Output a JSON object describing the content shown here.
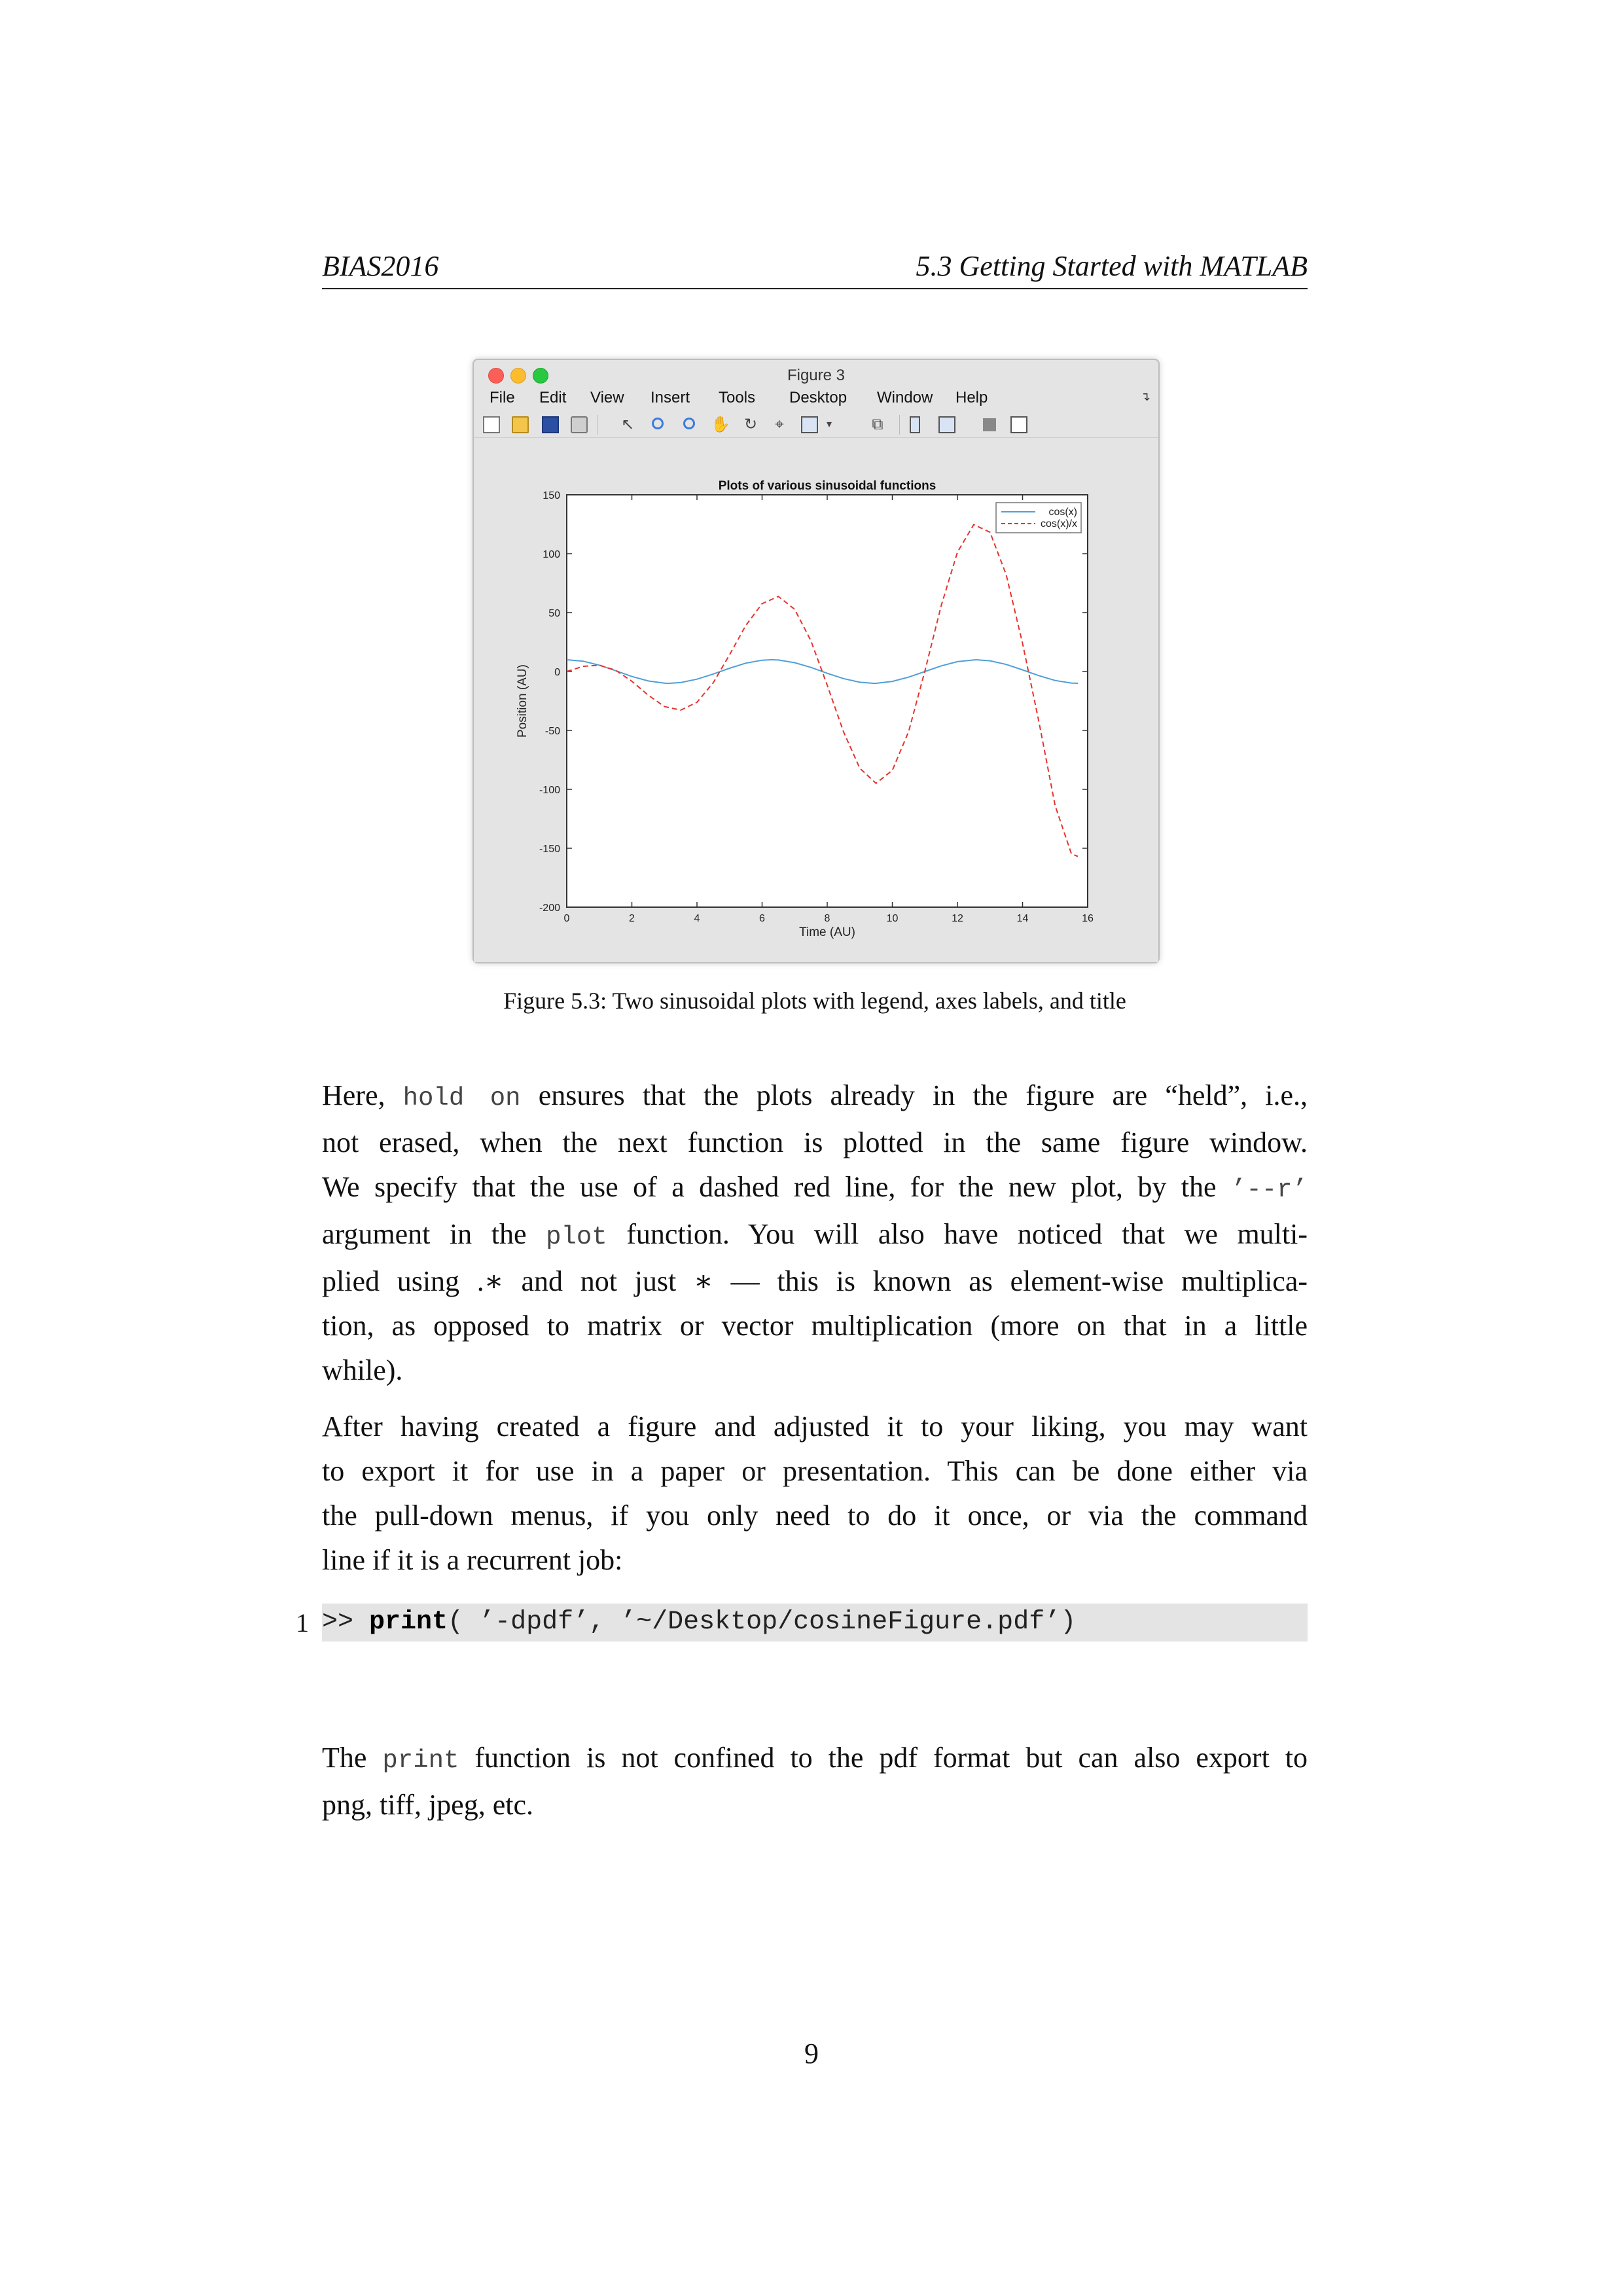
{
  "header": {
    "left": "BIAS2016",
    "right": "5.3 Getting Started with MATLAB"
  },
  "window": {
    "title": "Figure 3",
    "menu": [
      "File",
      "Edit",
      "View",
      "Insert",
      "Tools",
      "Desktop",
      "Window",
      "Help"
    ],
    "menu_overflow_icon": "arrow-icon",
    "toolbar_icons": [
      "new-figure-icon",
      "open-file-icon",
      "save-icon",
      "print-icon",
      "pointer-icon",
      "zoom-in-icon",
      "zoom-out-icon",
      "pan-icon",
      "rotate-icon",
      "data-cursor-icon",
      "brush-icon",
      "link-icon",
      "colorbar-icon",
      "legend-icon",
      "hide-tools-icon",
      "show-tools-icon"
    ]
  },
  "chart_data": {
    "type": "line",
    "title": "Plots of various sinusoidal functions",
    "xlabel": "Time (AU)",
    "ylabel": "Position (AU)",
    "xlim": [
      0,
      16
    ],
    "ylim": [
      -200,
      150
    ],
    "xticks": [
      "0",
      "2",
      "4",
      "6",
      "8",
      "10",
      "12",
      "14",
      "16"
    ],
    "yticks": [
      "150",
      "100",
      "50",
      "0",
      "-50",
      "-100",
      "-150",
      "-200"
    ],
    "grid": false,
    "legend_position": "top-right",
    "series": [
      {
        "name": "cos(x)",
        "style": "solid",
        "color": "#4f9fd8",
        "x": [
          0,
          0.5,
          1,
          1.5,
          2,
          2.5,
          3,
          3.14,
          3.5,
          4,
          4.5,
          5,
          5.5,
          6,
          6.28,
          6.5,
          7,
          7.5,
          8,
          8.5,
          9,
          9.42,
          9.5,
          10,
          10.5,
          11,
          11.5,
          12,
          12.57,
          13,
          13.5,
          14,
          14.5,
          15,
          15.5,
          15.7
        ],
        "y": [
          10,
          8.8,
          5.4,
          0.7,
          -4.2,
          -8,
          -9.9,
          -10,
          -9.4,
          -6.5,
          -2.1,
          2.8,
          7.1,
          9.6,
          10,
          9.8,
          7.5,
          3.5,
          -1.5,
          -6,
          -9.1,
          -10,
          -10,
          -8.4,
          -4.8,
          0,
          4.8,
          8.4,
          10,
          9.1,
          6,
          1.4,
          -3.5,
          -7.6,
          -9.8,
          -10
        ]
      },
      {
        "name": "cos(x)/x",
        "style": "dashed",
        "color": "#e3342f",
        "x": [
          0,
          0.5,
          1,
          1.5,
          2,
          2.5,
          3,
          3.5,
          4,
          4.5,
          5,
          5.5,
          6,
          6.5,
          7,
          7.5,
          8,
          8.5,
          9,
          9.5,
          10,
          10.5,
          11,
          11.5,
          12,
          12.5,
          13,
          13.5,
          14,
          14.5,
          15,
          15.5,
          15.7
        ],
        "y": [
          0,
          4.4,
          5.4,
          1.1,
          -8.3,
          -20,
          -29.7,
          -32.8,
          -26.1,
          -9.5,
          14.2,
          39.1,
          57.6,
          63.7,
          52.8,
          26.1,
          -11.6,
          -51.1,
          -82.1,
          -94.9,
          -83.9,
          -51,
          0.5,
          55.7,
          101.3,
          124.7,
          118.2,
          82,
          23.9,
          -42.4,
          -113.9,
          -154.6,
          -157
        ]
      }
    ]
  },
  "caption": "Figure 5.3: Two sinusoidal plots with legend, axes labels, and title",
  "para1": {
    "l1a": "Here, ",
    "l1code1": "hold on",
    "l1b": " ensures that the plots already in the figure are “held”, i.e.,",
    "l2": "not erased, when the next function is plotted in the same figure window.",
    "l3a": "We specify that the use of a dashed red line, for the new plot, by the ",
    "l3code": "’--r’",
    "l4a": "argument in the ",
    "l4code": "plot",
    "l4b": " function. You will also have noticed that we multi-",
    "l5": "plied using .∗ and not just ∗ — this is known as element-wise multiplica-",
    "l6": "tion, as opposed to matrix or vector multiplication (more on that in a little",
    "l7": "while)."
  },
  "para2": {
    "l1": "After having created a figure and adjusted it to your liking, you may want",
    "l2": "to export it for use in a paper or presentation. This can be done either via",
    "l3": "the pull-down menus, if you only need to do it once, or via the command",
    "l4": "line if it is a recurrent job:"
  },
  "code": {
    "line_number": "1",
    "prompt": ">> ",
    "keyword": "print",
    "args": "( ’-dpdf’, ’~/Desktop/cosineFigure.pdf’)"
  },
  "para3": {
    "l1a": "The ",
    "l1code": "print",
    "l1b": " function is not confined to the pdf format but can also export to",
    "l2": "png, tiff, jpeg, etc."
  },
  "page_number": "9"
}
